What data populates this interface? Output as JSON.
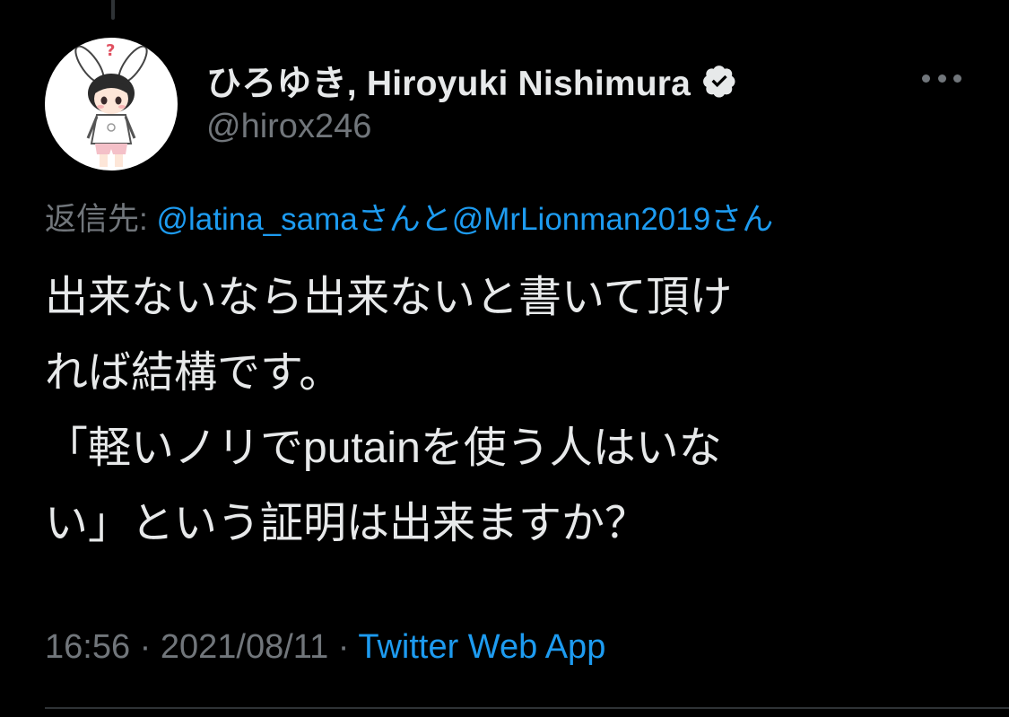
{
  "author": {
    "display_name": "ひろゆき, Hiroyuki Nishimura",
    "handle": "@hirox246",
    "avatar_icon": "bunny-ear-character-avatar",
    "verified_icon": "verified-badge-icon"
  },
  "reply": {
    "prefix": "返信先: ",
    "mention_1": "@latina_sama",
    "joiner": "さんと",
    "mention_2": "@MrLionman2019",
    "suffix": "さん"
  },
  "tweet": {
    "lines": [
      "出来ないなら出来ないと書いて頂け",
      "れば結構です。",
      "「軽いノリでputainを使う人はいな",
      "い」という証明は出来ますか？"
    ]
  },
  "meta": {
    "time": "16:56",
    "separator_1": " · ",
    "date": "2021/08/11",
    "separator_2": " · ",
    "source": "Twitter Web App"
  },
  "colors": {
    "background": "#000000",
    "text": "#e7e9ea",
    "secondary": "#71767b",
    "accent": "#1d9bf0",
    "divider": "#2f3336"
  }
}
